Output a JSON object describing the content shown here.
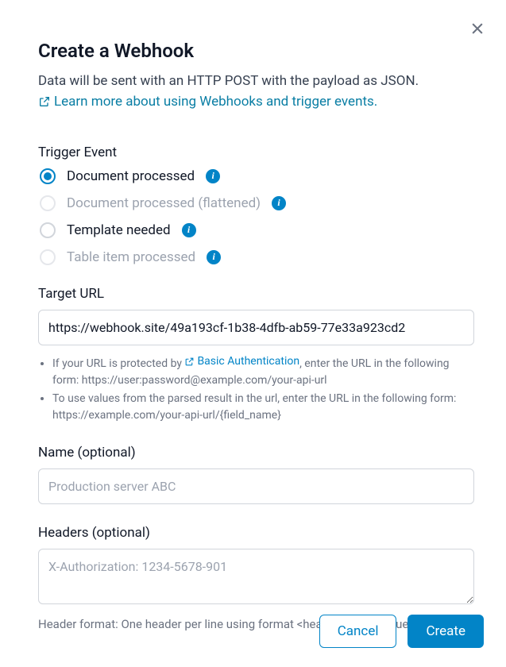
{
  "modal": {
    "title": "Create a Webhook",
    "description": "Data will be sent with an HTTP POST with the payload as JSON.",
    "learn_more": "Learn more about using Webhooks and trigger events."
  },
  "trigger": {
    "label": "Trigger Event",
    "options": [
      {
        "label": "Document processed",
        "selected": true,
        "disabled": false
      },
      {
        "label": "Document processed (flattened)",
        "selected": false,
        "disabled": true
      },
      {
        "label": "Template needed",
        "selected": false,
        "disabled": false
      },
      {
        "label": "Table item processed",
        "selected": false,
        "disabled": true
      }
    ]
  },
  "target_url": {
    "label": "Target URL",
    "value": "https://webhook.site/49a193cf-1b38-4dfb-ab59-77e33a923cd2",
    "hint1_pre": "If your URL is protected by ",
    "hint1_link": "Basic Authentication",
    "hint1_post": ", enter the URL in the following form: https://user:password@example.com/your-api-url",
    "hint2": "To use values from the parsed result in the url, enter the URL in the following form: https://example.com/your-api-url/{field_name}"
  },
  "name": {
    "label": "Name (optional)",
    "placeholder": "Production server ABC",
    "value": ""
  },
  "headers": {
    "label": "Headers (optional)",
    "placeholder": "X-Authorization: 1234-5678-901",
    "value": "",
    "hint": "Header format: One header per line using format <header_key>: <value>"
  },
  "footer": {
    "cancel": "Cancel",
    "create": "Create"
  }
}
